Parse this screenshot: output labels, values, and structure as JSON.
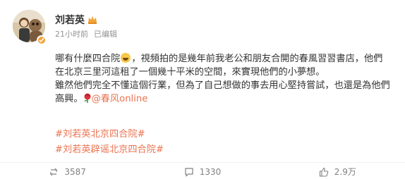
{
  "author": {
    "name": "刘若英",
    "vip_color": "#f2a33a"
  },
  "meta": {
    "time": "21小时前",
    "edited": "已编辑"
  },
  "content": {
    "line1a": "哪有什麼四合院",
    "line1b": "，視頻拍的是幾年前我老公和朋友合開的春風習習書店，他們",
    "line2": "在北京三里河這租了一個幾十平米的空間，來實現他們的小夢想。",
    "line3": "雖然他們完全不懂這個行業，但為了自己想做的事去用心堅持嘗試，也還是為他們",
    "line4a": "高興。",
    "mention": "@春风online"
  },
  "hashtags": [
    "#刘若英北京四合院#",
    "#刘若英辟谣北京四合院#"
  ],
  "actions": {
    "repost_count": "3587",
    "comment_count": "1330",
    "like_count": "2.9万"
  },
  "colors": {
    "link": "#eb7350",
    "meta_text": "#939393"
  },
  "icons": {
    "repost": "repost-icon",
    "comment": "comment-icon",
    "like": "thumbs-up-icon"
  }
}
